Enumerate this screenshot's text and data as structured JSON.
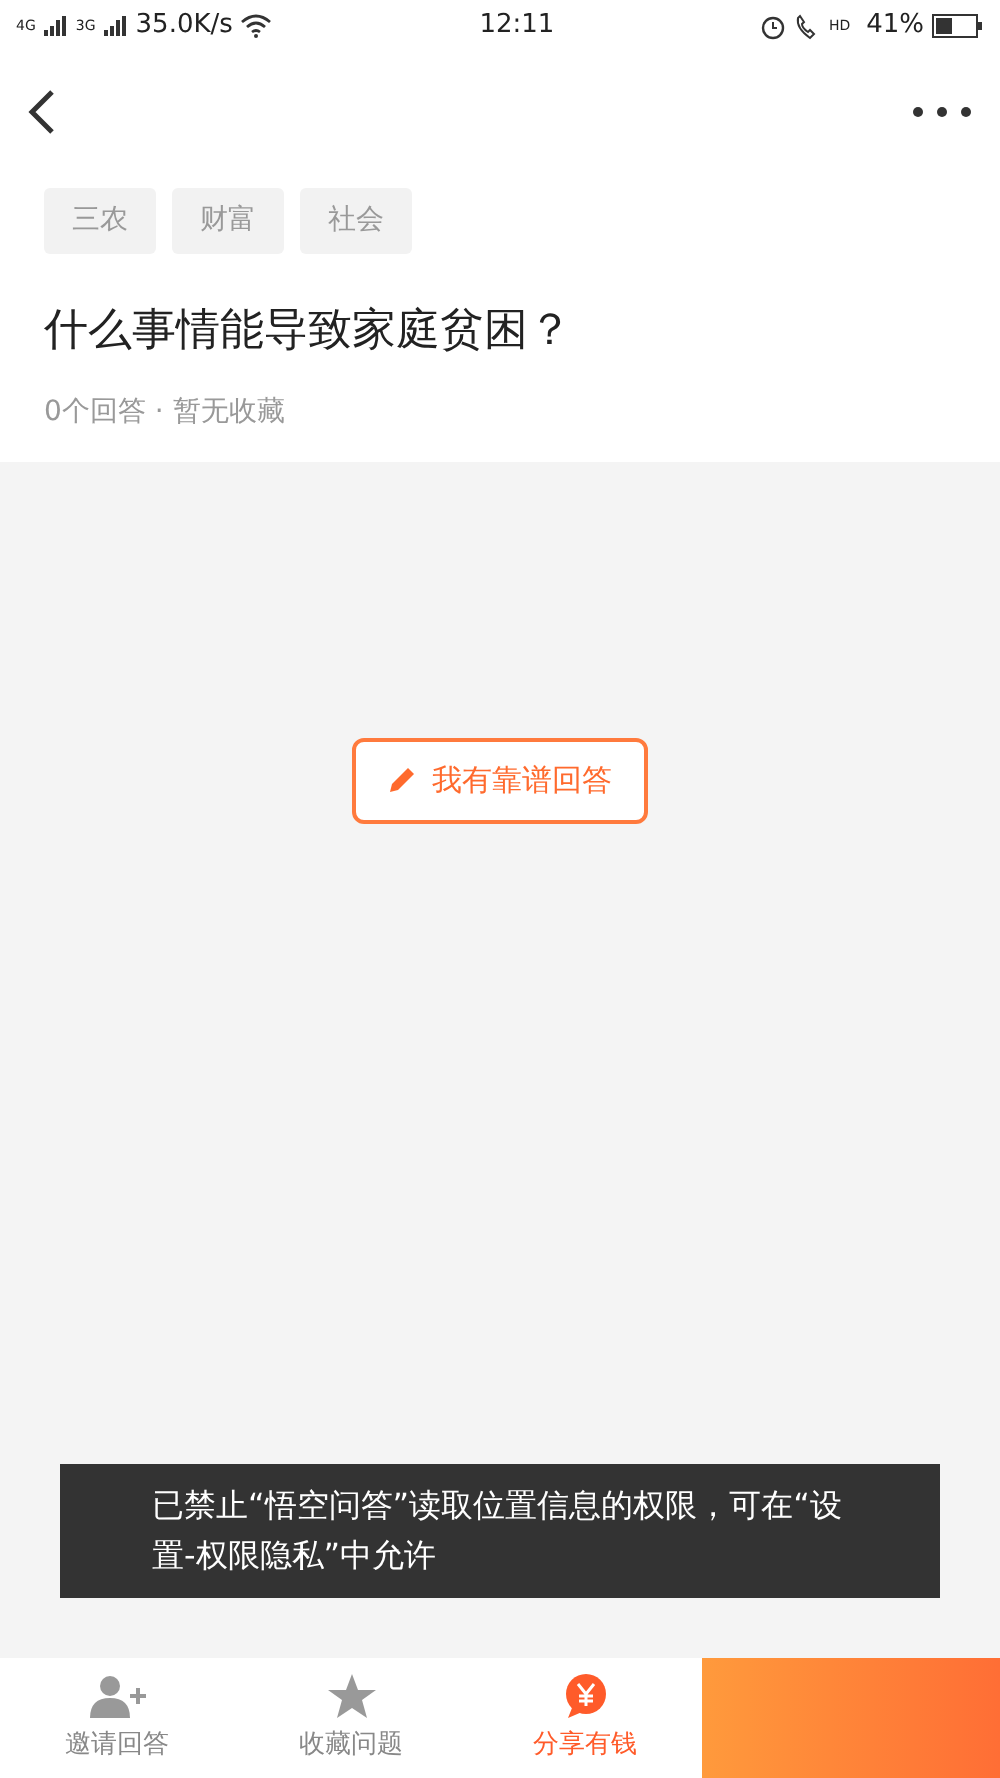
{
  "status_bar": {
    "net1": "4G",
    "net2": "3G",
    "speed": "35.0K/s",
    "time": "12:11",
    "hd": "HD",
    "battery": "41%"
  },
  "tags": [
    "三农",
    "财富",
    "社会"
  ],
  "question": {
    "title": "什么事情能导致家庭贫困？",
    "meta": "0个回答 · 暂无收藏"
  },
  "answer_button": "我有靠谱回答",
  "toast": "已禁止“悟空问答”读取位置信息的权限，可在“设置-权限隐私”中允许",
  "bottom_bar": [
    {
      "kind": "invite",
      "label": "邀请回答",
      "highlight": false
    },
    {
      "kind": "star",
      "label": "收藏问题",
      "highlight": false
    },
    {
      "kind": "share",
      "label": "分享有钱",
      "highlight": true
    }
  ]
}
